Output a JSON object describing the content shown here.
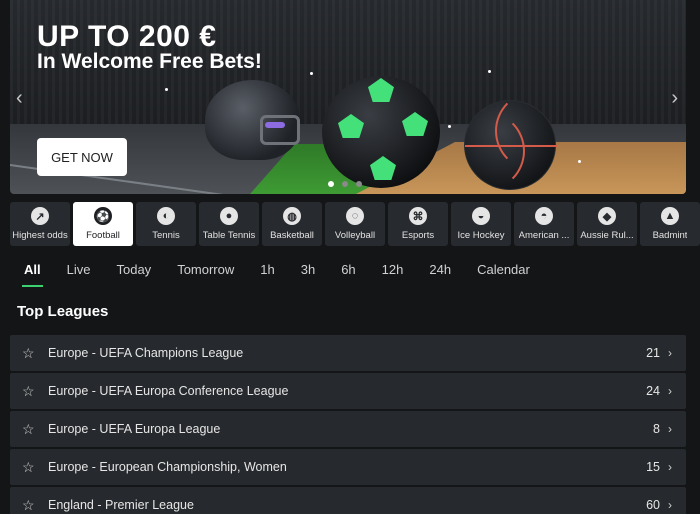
{
  "banner": {
    "title": "UP TO 200 €",
    "subtitle": "In Welcome Free Bets!",
    "cta": "GET NOW",
    "prev_icon": "chevron-left-icon",
    "next_icon": "chevron-right-icon",
    "slides": 3,
    "active_slide": 1
  },
  "sports": [
    {
      "label": "Highest odds",
      "icon": "trend-up-icon",
      "glyph": "↗",
      "active": false
    },
    {
      "label": "Football",
      "icon": "soccer-ball-icon",
      "glyph": "⚽",
      "active": true
    },
    {
      "label": "Tennis",
      "icon": "tennis-ball-icon",
      "glyph": "◐",
      "active": false
    },
    {
      "label": "Table Tennis",
      "icon": "table-tennis-icon",
      "glyph": "●",
      "active": false
    },
    {
      "label": "Basketball",
      "icon": "basketball-icon",
      "glyph": "◍",
      "active": false
    },
    {
      "label": "Volleyball",
      "icon": "volleyball-icon",
      "glyph": "◌",
      "active": false
    },
    {
      "label": "Esports",
      "icon": "gamepad-icon",
      "glyph": "⌘",
      "active": false
    },
    {
      "label": "Ice Hockey",
      "icon": "hockey-puck-icon",
      "glyph": "◒",
      "active": false
    },
    {
      "label": "American ...",
      "icon": "football-helmet-icon",
      "glyph": "◓",
      "active": false
    },
    {
      "label": "Aussie Rul...",
      "icon": "rugby-ball-icon",
      "glyph": "◆",
      "active": false
    },
    {
      "label": "Badmint",
      "icon": "shuttlecock-icon",
      "glyph": "▲",
      "active": false
    }
  ],
  "time_tabs": [
    {
      "label": "All",
      "active": true
    },
    {
      "label": "Live",
      "active": false
    },
    {
      "label": "Today",
      "active": false
    },
    {
      "label": "Tomorrow",
      "active": false
    },
    {
      "label": "1h",
      "active": false
    },
    {
      "label": "3h",
      "active": false
    },
    {
      "label": "6h",
      "active": false
    },
    {
      "label": "12h",
      "active": false
    },
    {
      "label": "24h",
      "active": false
    },
    {
      "label": "Calendar",
      "active": false
    }
  ],
  "section_title": "Top Leagues",
  "leagues": [
    {
      "name": "Europe - UEFA Champions League",
      "count": "21"
    },
    {
      "name": "Europe - UEFA Europa Conference League",
      "count": "24"
    },
    {
      "name": "Europe - UEFA Europa League",
      "count": "8"
    },
    {
      "name": "Europe - European Championship, Women",
      "count": "15"
    },
    {
      "name": "England - Premier League",
      "count": "60"
    }
  ],
  "colors": {
    "background": "#131517",
    "row": "#26292d",
    "accent": "#3bd16f",
    "soccer_patch": "#44e07a",
    "basket_seam": "#d45b4a"
  }
}
